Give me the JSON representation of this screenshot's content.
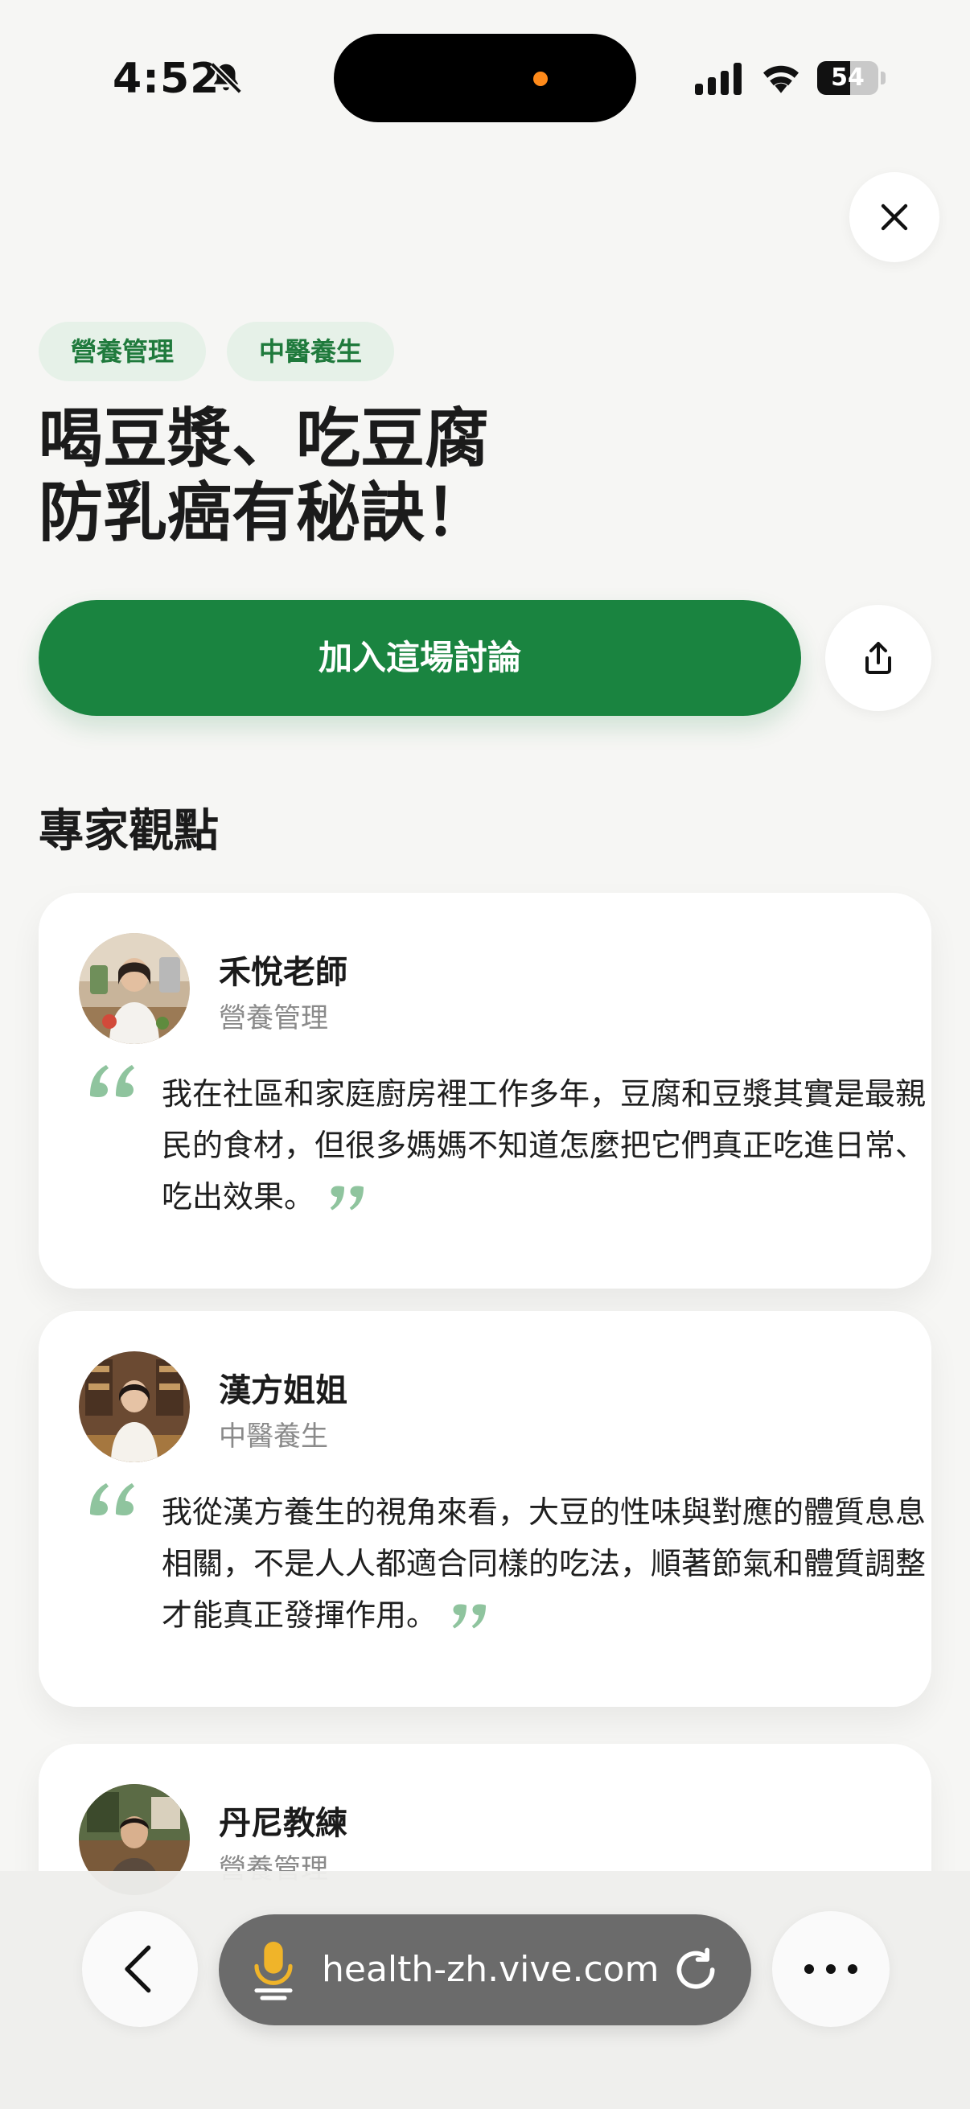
{
  "status_bar": {
    "time": "4:52",
    "battery": "54",
    "battery_level": 0.54,
    "silent_icon": "bell-slash-icon",
    "signal_icon": "cellular-signal-icon",
    "wifi_icon": "wifi-icon"
  },
  "header": {
    "close_icon": "close-icon",
    "tags": [
      "營養管理",
      "中醫養生"
    ],
    "title": "喝豆漿、吃豆腐\n防乳癌有秘訣！",
    "join_label": "加入這場討論",
    "share_icon": "share-icon"
  },
  "section": {
    "title": "專家觀點"
  },
  "experts": [
    {
      "name": "禾悅老師",
      "category": "營養管理",
      "quote": "我在社區和家庭廚房裡工作多年，豆腐和豆漿其實是最親民的食材，但很多媽媽不知道怎麼把它們真正吃進日常、吃出效果。"
    },
    {
      "name": "漢方姐姐",
      "category": "中醫養生",
      "quote": "我從漢方養生的視角來看，大豆的性味與對應的體質息息相關，不是人人都適合同樣的吃法，順著節氣和體質調整才能真正發揮作用。"
    },
    {
      "name": "丹尼教練",
      "category": "營養管理",
      "quote": ""
    }
  ],
  "browser": {
    "url": "health-zh.vive.com",
    "back_icon": "chevron-left-icon",
    "mic_icon": "microphone-icon",
    "reload_icon": "reload-icon",
    "more_icon": "more-icon"
  },
  "colors": {
    "accent": "#1a8440",
    "tag_bg": "#e6f1e8",
    "tag_text": "#1f7a3c",
    "quote_mark": "#8fc49e",
    "background": "#f6f6f4"
  }
}
